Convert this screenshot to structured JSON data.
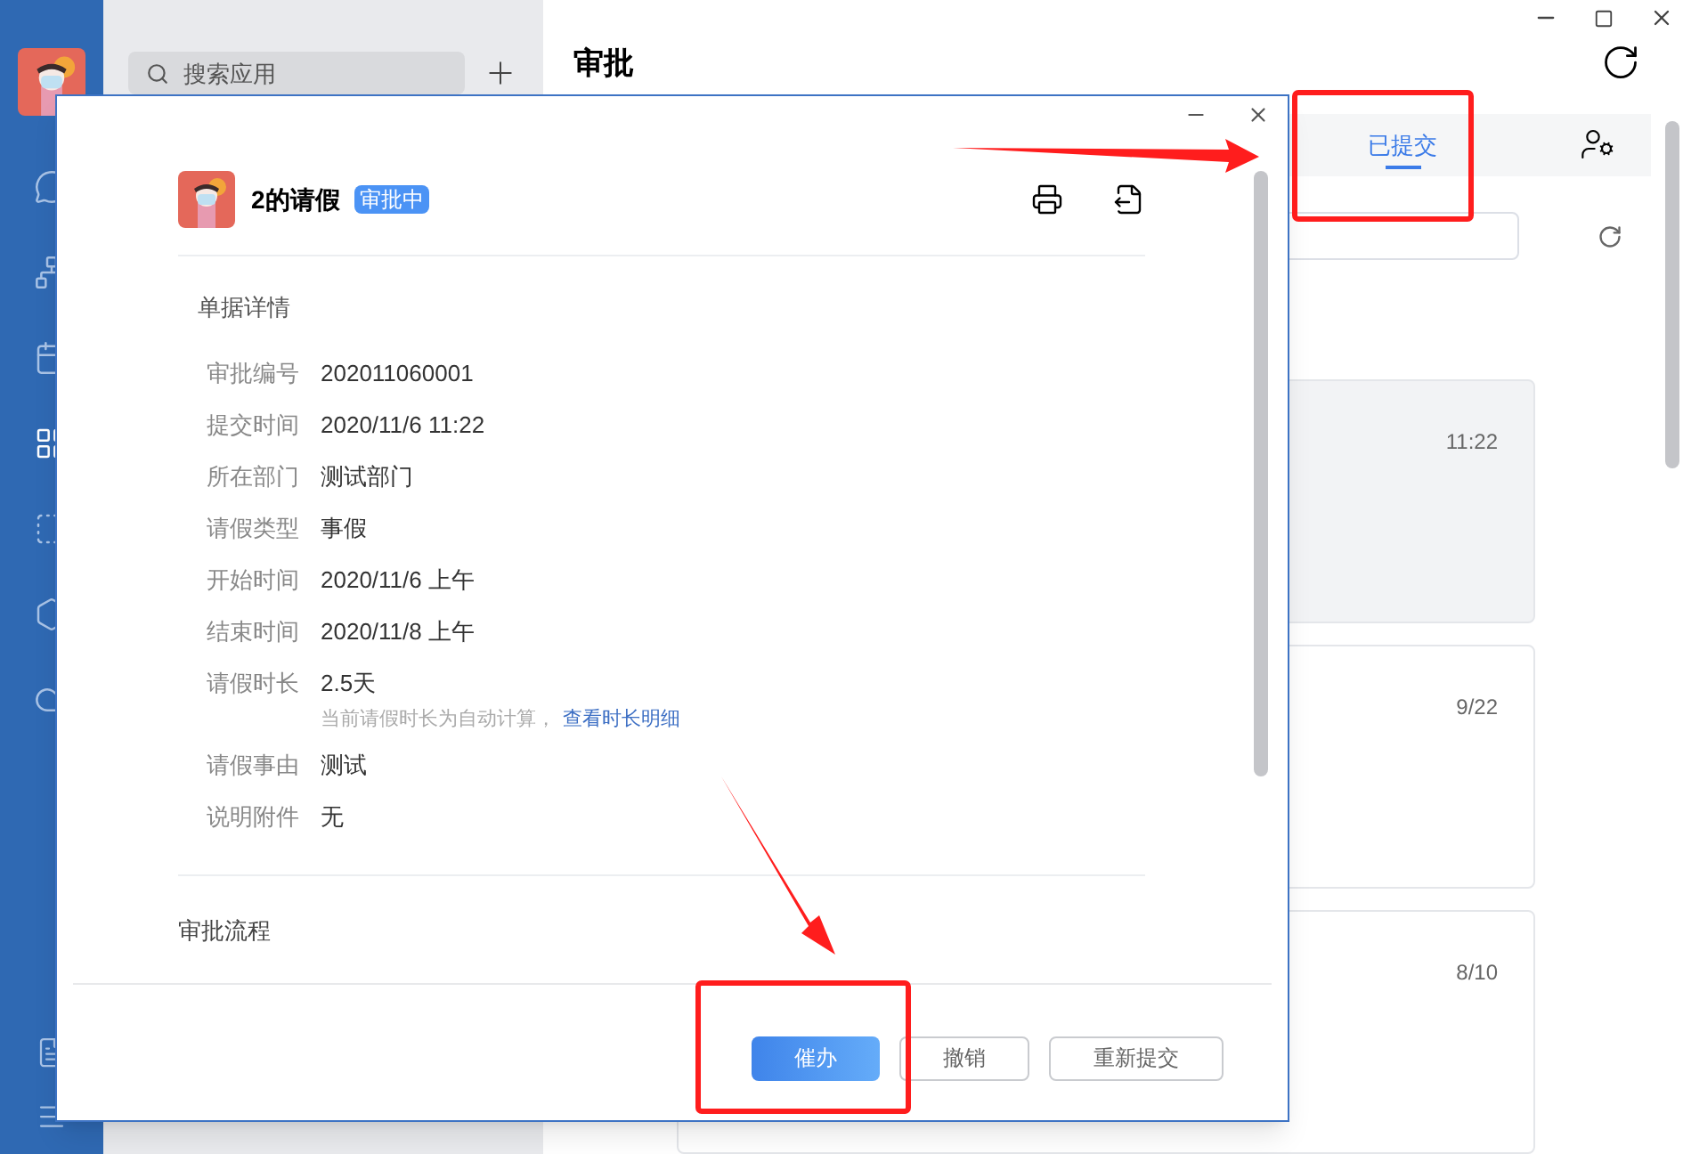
{
  "sidebar": {
    "items": [
      {
        "kind": "chat",
        "selected": false
      },
      {
        "kind": "org",
        "selected": false
      },
      {
        "kind": "calendar",
        "selected": false
      },
      {
        "kind": "apps",
        "selected": true
      },
      {
        "kind": "doc",
        "selected": false
      },
      {
        "kind": "hexagon",
        "selected": false
      },
      {
        "kind": "cloud",
        "selected": false
      },
      {
        "kind": "notes",
        "selected": false
      },
      {
        "kind": "menu",
        "selected": false
      }
    ]
  },
  "app_list": {
    "search": {
      "placeholder": "搜索应用"
    }
  },
  "main": {
    "title": "审批",
    "tabs": [
      {
        "label": "已提交",
        "selected": true
      }
    ],
    "cards": [
      {
        "time": "11:22",
        "selected": true
      },
      {
        "time": "9/22",
        "selected": false
      },
      {
        "time": "8/10",
        "selected": false
      }
    ]
  },
  "dialog": {
    "title": "2的请假",
    "status": "审批中",
    "section_title": "单据详情",
    "fields": [
      {
        "label": "审批编号",
        "value": "202011060001"
      },
      {
        "label": "提交时间",
        "value": "2020/11/6 11:22"
      },
      {
        "label": "所在部门",
        "value": "测试部门"
      },
      {
        "label": "请假类型",
        "value": "事假"
      },
      {
        "label": "开始时间",
        "value": "2020/11/6 上午"
      },
      {
        "label": "结束时间",
        "value": "2020/11/8 上午"
      },
      {
        "label": "请假时长",
        "value": "2.5天",
        "note": "当前请假时长为自动计算，",
        "link": "查看时长明细"
      },
      {
        "label": "请假事由",
        "value": "测试"
      },
      {
        "label": "说明附件",
        "value": "无"
      }
    ],
    "flow_title": "审批流程",
    "buttons": [
      {
        "label": "催办",
        "kind": "primary"
      },
      {
        "label": "撤销",
        "kind": "default"
      },
      {
        "label": "重新提交",
        "kind": "default"
      }
    ]
  }
}
